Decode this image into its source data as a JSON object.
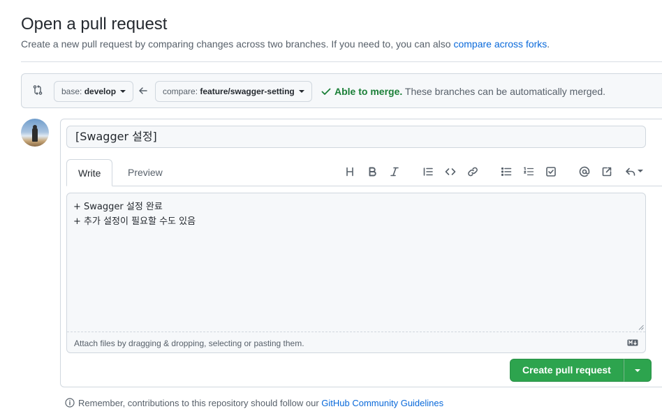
{
  "page": {
    "title": "Open a pull request",
    "subtitle": "Create a new pull request by comparing changes across two branches. If you need to, you can also ",
    "subtitle_link": "compare across forks",
    "subtitle_end": "."
  },
  "range": {
    "base_label": "base:",
    "base_value": "develop",
    "compare_label": "compare:",
    "compare_value": "feature/swagger-setting",
    "merge_ok": "Able to merge.",
    "merge_text": " These branches can be automatically merged."
  },
  "form": {
    "title_value": "[Swagger 설정]",
    "tabs": [
      "Write",
      "Preview"
    ],
    "body_text": "+ Swagger 설정 완료\n+ 추가 설정이 필요할 수도 있음",
    "attach_hint": "Attach files by dragging & dropping, selecting or pasting them.",
    "submit_label": "Create pull request"
  },
  "toolbar": {
    "icons": [
      "heading-icon",
      "bold-icon",
      "italic-icon",
      "quote-icon",
      "code-icon",
      "link-icon",
      "unordered-list-icon",
      "ordered-list-icon",
      "task-list-icon",
      "mention-icon",
      "reference-icon",
      "reply-icon"
    ]
  },
  "footer": {
    "text": "Remember, contributions to this repository should follow our ",
    "link": "GitHub Community Guidelines"
  },
  "colors": {
    "accent_link": "#0969da",
    "merge_ok": "#1a7f37",
    "primary_button": "#2da44e"
  }
}
